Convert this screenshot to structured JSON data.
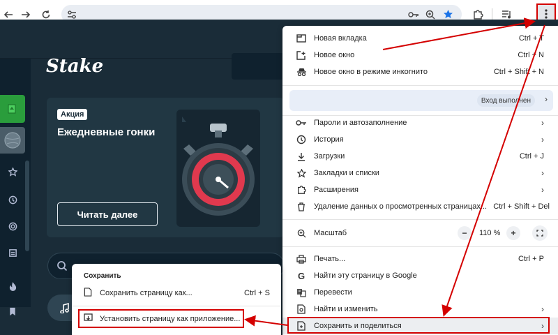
{
  "browser": {
    "back_icon": "arrow-left-icon",
    "forward_icon": "arrow-right-icon",
    "reload_icon": "reload-icon",
    "site_info_icon": "tune-icon",
    "password_icon": "key-icon",
    "zoom_icon": "magnifier-icon",
    "bookmark_icon": "star-icon",
    "extensions_icon": "puzzle-icon",
    "media_icon": "media-control-icon",
    "menu_icon": "three-dots-vertical-icon",
    "accent_color": "#1a73e8",
    "highlight_color": "#d40000"
  },
  "site": {
    "logo": "Stake",
    "promo": {
      "badge": "Акция",
      "title": "Ежедневные гонки",
      "button": "Читать далее"
    },
    "sidebar_icons": [
      "star-icon",
      "history-icon",
      "target-icon",
      "receipt-icon",
      "fire-icon",
      "bookmark-icon"
    ]
  },
  "menu": {
    "items": {
      "new_tab": {
        "label": "Новая вкладка",
        "shortcut": "Ctrl + T"
      },
      "new_window": {
        "label": "Новое окно",
        "shortcut": "Ctrl + N"
      },
      "incognito": {
        "label": "Новое окно в режиме инкогнито",
        "shortcut": "Ctrl + Shift + N"
      },
      "profile": {
        "status": "Вход выполнен"
      },
      "passwords": {
        "label": "Пароли и автозаполнение"
      },
      "history": {
        "label": "История"
      },
      "downloads": {
        "label": "Загрузки",
        "shortcut": "Ctrl + J"
      },
      "bookmarks": {
        "label": "Закладки и списки"
      },
      "extensions": {
        "label": "Расширения"
      },
      "clear_data": {
        "label": "Удаление данных о просмотренных страницах...",
        "shortcut": "Ctrl + Shift + Del"
      },
      "zoom": {
        "label": "Масштаб",
        "minus": "−",
        "value": "110 %",
        "plus": "+"
      },
      "print": {
        "label": "Печать...",
        "shortcut": "Ctrl + P"
      },
      "google": {
        "label": "Найти эту страницу в Google"
      },
      "translate": {
        "label": "Перевести"
      },
      "find": {
        "label": "Найти и изменить"
      },
      "save_share": {
        "label": "Сохранить и поделиться"
      }
    }
  },
  "submenu": {
    "title": "Сохранить",
    "save_page": {
      "label": "Сохранить страницу как...",
      "shortcut": "Ctrl + S"
    },
    "install_app": {
      "label": "Установить страницу как приложение..."
    }
  }
}
